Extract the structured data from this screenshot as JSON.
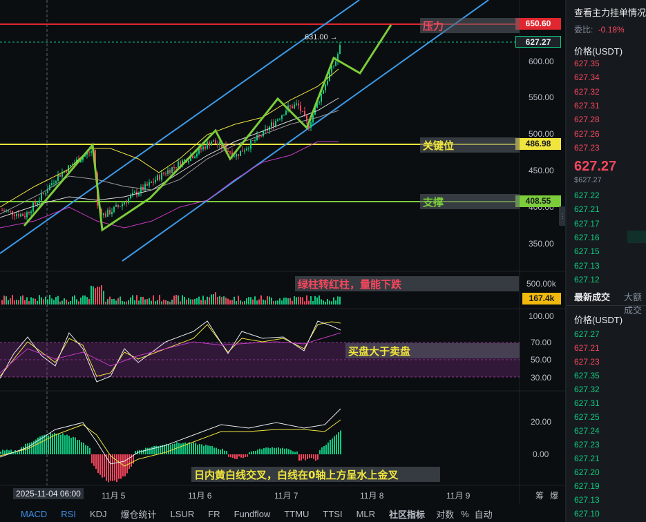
{
  "price_axis": {
    "ticks": [
      "600.00",
      "550.00",
      "500.00",
      "450.00",
      "400.00",
      "350.00"
    ],
    "tags": {
      "resistance": "650.60",
      "current": "627.27",
      "key": "486.98",
      "support": "408.55"
    },
    "high_marker": "631.00 →"
  },
  "annotations": {
    "resistance": "压力",
    "key_level": "关键位",
    "support": "支撑",
    "volume_note": "绿柱转红柱，量能下跌",
    "rsi_note": "买盘大于卖盘",
    "macd_note": "日内黄白线交叉，白线在0轴上方呈水上金叉"
  },
  "volume_axis": {
    "tick": "500.00k",
    "current": "167.4k"
  },
  "rsi_axis": {
    "ticks": [
      "100.00",
      "70.00",
      "50.00",
      "30.00"
    ]
  },
  "macd_axis": {
    "ticks": [
      "20.00",
      "0.00"
    ]
  },
  "time_axis": {
    "cursor_label": "2025-11-04 06:00",
    "labels": [
      "11月 5",
      "11月 6",
      "11月 7",
      "11月 8",
      "11月 9"
    ],
    "right_icons": [
      "筹",
      "爆"
    ]
  },
  "indicator_tabs": [
    "MACD",
    "RSI",
    "KDJ",
    "爆仓统计",
    "LSUR",
    "FR",
    "Fundflow",
    "TTMU",
    "TTSI",
    "MLR",
    "社区指标",
    "对数",
    "%",
    "自动"
  ],
  "right_panel": {
    "title": "查看主力挂单情况",
    "ratio_label": "委比:",
    "ratio_value": "-0.18%",
    "price_header": "价格(USDT)",
    "asks": [
      "627.35",
      "627.34",
      "627.32",
      "627.31",
      "627.28",
      "627.26",
      "627.23"
    ],
    "last_price": "627.27",
    "last_price_usd": "$627.27",
    "bids": [
      "627.22",
      "627.21",
      "627.17",
      "627.16",
      "627.15",
      "627.13",
      "627.12"
    ],
    "trades_tab": "最新成交",
    "trades_tab2": "大额成交",
    "trades_header": "价格(USDT)",
    "trades": [
      {
        "p": "627.27",
        "c": "green"
      },
      {
        "p": "627.21",
        "c": "red"
      },
      {
        "p": "627.23",
        "c": "red"
      },
      {
        "p": "627.35",
        "c": "green"
      },
      {
        "p": "627.32",
        "c": "green"
      },
      {
        "p": "627.31",
        "c": "green"
      },
      {
        "p": "627.25",
        "c": "green"
      },
      {
        "p": "627.24",
        "c": "green"
      },
      {
        "p": "627.23",
        "c": "green"
      },
      {
        "p": "627.21",
        "c": "green"
      },
      {
        "p": "627.20",
        "c": "green"
      },
      {
        "p": "627.19",
        "c": "green"
      },
      {
        "p": "627.13",
        "c": "green"
      },
      {
        "p": "627.10",
        "c": "green"
      }
    ]
  },
  "colors": {
    "up": "#0ecb81",
    "down": "#f6465d",
    "resistance": "#e0262e",
    "key": "#f0e53c",
    "support": "#7ccd3a",
    "channel": "#3c9ae8"
  }
}
